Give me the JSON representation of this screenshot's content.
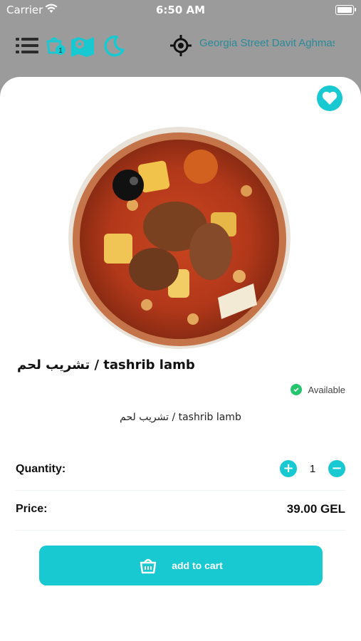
{
  "status_bar": {
    "carrier": "Carrier",
    "time": "6:50 AM",
    "wifi_icon": "wifi-icon",
    "battery_icon": "battery-icon"
  },
  "topnav": {
    "menu_icon": "menu-icon",
    "basket_icon": "basket-icon",
    "basket_badge": "1",
    "map_icon": "map-icon",
    "theme_icon": "moon-icon",
    "location_icon": "target-icon",
    "location_text": "Georgia Street Davit Aghmashenebeli"
  },
  "product": {
    "favorite_icon": "heart-icon",
    "image_alt_icon": "dish-image",
    "title": "تشريب لحم / tashrib lamb",
    "availability": "Available",
    "availability_icon": "check-icon",
    "description": "تشريب لحم / tashrib lamb",
    "quantity_label": "Quantity:",
    "quantity_value": "1",
    "increase_icon": "plus-icon",
    "decrease_icon": "minus-icon",
    "price_label": "Price:",
    "price_value": "39.00 GEL",
    "add_to_cart_label": "add to cart",
    "cart_icon": "cart-icon"
  },
  "colors": {
    "accent": "#19c9d1",
    "topbar_bg": "#9b9b9b",
    "location_text": "#2a8a99",
    "available": "#27c46e"
  }
}
